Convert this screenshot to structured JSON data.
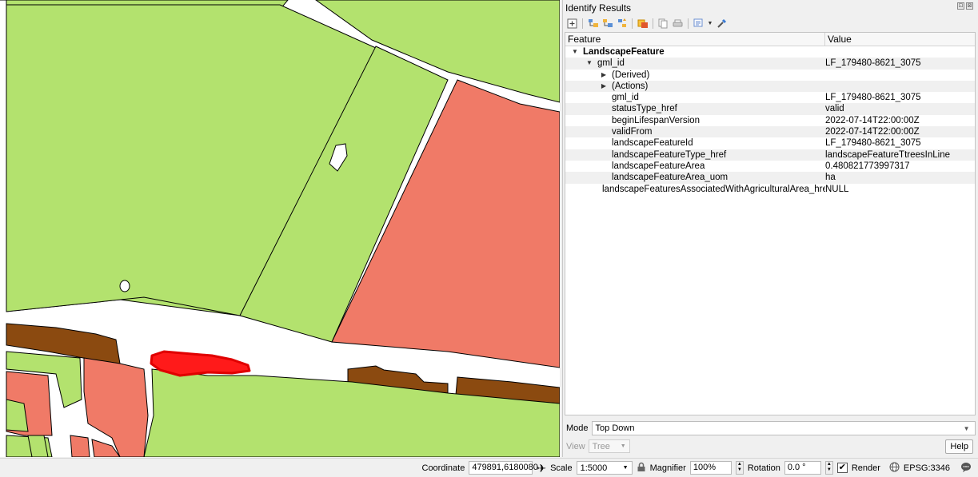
{
  "panel": {
    "title": "Identify Results",
    "title_btns": [
      "⊡",
      "⊠"
    ],
    "columns": {
      "feature": "Feature",
      "value": "Value"
    },
    "rows": [
      {
        "indent": 0,
        "arrow": "▼",
        "label": "LandscapeFeature",
        "value": "",
        "bold": true
      },
      {
        "indent": 1,
        "arrow": "▼",
        "label": "gml_id",
        "value": "LF_179480-8621_3075",
        "bold": false
      },
      {
        "indent": 2,
        "arrow": "▶",
        "label": "(Derived)",
        "value": "",
        "bold": false
      },
      {
        "indent": 2,
        "arrow": "▶",
        "label": "(Actions)",
        "value": "",
        "bold": false
      },
      {
        "indent": 2,
        "arrow": "",
        "label": "gml_id",
        "value": "LF_179480-8621_3075",
        "bold": false
      },
      {
        "indent": 2,
        "arrow": "",
        "label": "statusType_href",
        "value": "valid",
        "bold": false
      },
      {
        "indent": 2,
        "arrow": "",
        "label": "beginLifespanVersion",
        "value": "2022-07-14T22:00:00Z",
        "bold": false
      },
      {
        "indent": 2,
        "arrow": "",
        "label": "validFrom",
        "value": "2022-07-14T22:00:00Z",
        "bold": false
      },
      {
        "indent": 2,
        "arrow": "",
        "label": "landscapeFeatureId",
        "value": "LF_179480-8621_3075",
        "bold": false
      },
      {
        "indent": 2,
        "arrow": "",
        "label": "landscapeFeatureType_href",
        "value": "landscapeFeatureTtreesInLine",
        "bold": false
      },
      {
        "indent": 2,
        "arrow": "",
        "label": "landscapeFeatureArea",
        "value": "0.480821773997317",
        "bold": false
      },
      {
        "indent": 2,
        "arrow": "",
        "label": "landscapeFeatureArea_uom",
        "value": "ha",
        "bold": false
      },
      {
        "indent": 2,
        "arrow": "",
        "label": "landscapeFeaturesAssociatedWithAgriculturalArea_href",
        "value": "NULL",
        "bold": false
      }
    ],
    "mode_label": "Mode",
    "mode_value": "Top Down",
    "view_label": "View",
    "view_value": "Tree",
    "help_label": "Help"
  },
  "statusbar": {
    "coordinate_label": "Coordinate",
    "coordinate_value": "479891,6180080",
    "scale_label": "Scale",
    "scale_value": "1:5000",
    "magnifier_label": "Magnifier",
    "magnifier_value": "100%",
    "rotation_label": "Rotation",
    "rotation_value": "0.0 °",
    "render_label": "Render",
    "render_checked": "✔",
    "crs_label": "EPSG:3346"
  },
  "colors": {
    "field_green": "#b3e26e",
    "field_red": "#f07a67",
    "tree_line_brown": "#8b4a10",
    "selection_red": "#ff1a1a"
  },
  "icons": [
    "expand-icon",
    "expand-all-icon",
    "collapse-all-icon",
    "expand-new-icon",
    "highlight-icon",
    "copy-icon",
    "print-icon",
    "identify-mode-icon",
    "settings-icon",
    "pan-to-icon",
    "lock-icon",
    "crs-globe-icon",
    "messages-icon"
  ]
}
